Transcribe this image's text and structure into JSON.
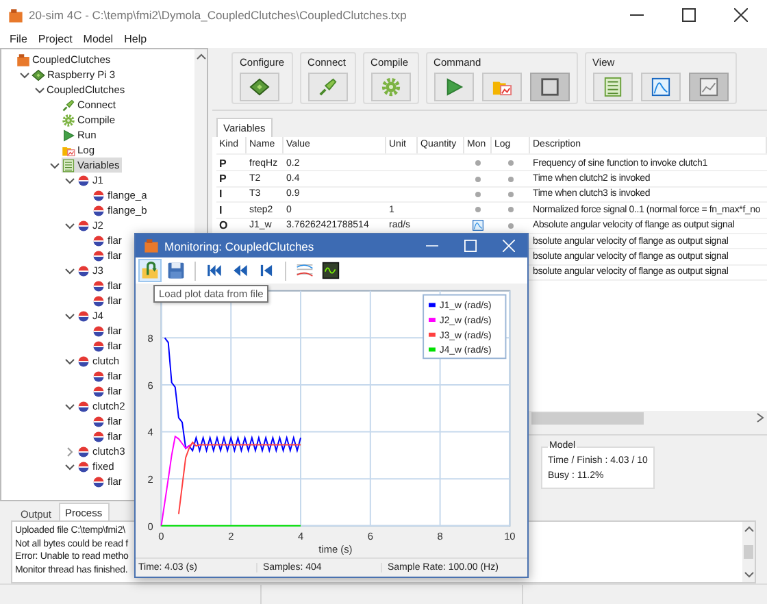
{
  "window": {
    "title": "20-sim 4C - C:\\temp\\fmi2\\Dymola_CoupledClutches\\CoupledClutches.txp"
  },
  "menu": [
    "File",
    "Project",
    "Model",
    "Help"
  ],
  "tree": [
    {
      "label": "CoupledClutches",
      "kind": "project",
      "selected": false,
      "children": [
        {
          "label": "Raspberry Pi 3",
          "kind": "board",
          "selected": false,
          "expanded": true,
          "children": [
            {
              "label": "CoupledClutches",
              "selected": false,
              "expanded": true,
              "children": [
                {
                  "label": "Connect",
                  "kind": "connect",
                  "selected": false
                },
                {
                  "label": "Compile",
                  "kind": "compile",
                  "selected": false
                },
                {
                  "label": "Run",
                  "kind": "run",
                  "selected": false
                },
                {
                  "label": "Log",
                  "kind": "log",
                  "selected": false
                },
                {
                  "label": "Variables",
                  "kind": "variables",
                  "selected": true,
                  "expanded": true,
                  "children": [
                    {
                      "label": "J1",
                      "kind": "submodel",
                      "selected": false,
                      "expanded": true,
                      "children": [
                        {
                          "label": "flange_a",
                          "kind": "port",
                          "selected": false
                        },
                        {
                          "label": "flange_b",
                          "kind": "port",
                          "selected": false
                        }
                      ]
                    },
                    {
                      "label": "J2",
                      "kind": "submodel",
                      "selected": false,
                      "expanded": true,
                      "children": [
                        {
                          "label": "flar",
                          "kind": "port",
                          "selected": false
                        },
                        {
                          "label": "flar",
                          "kind": "port",
                          "selected": false
                        }
                      ]
                    },
                    {
                      "label": "J3",
                      "kind": "submodel",
                      "selected": false,
                      "expanded": true,
                      "children": [
                        {
                          "label": "flar",
                          "kind": "port",
                          "selected": false
                        },
                        {
                          "label": "flar",
                          "kind": "port",
                          "selected": false
                        }
                      ]
                    },
                    {
                      "label": "J4",
                      "kind": "submodel",
                      "selected": false,
                      "expanded": true,
                      "children": [
                        {
                          "label": "flar",
                          "kind": "port",
                          "selected": false
                        },
                        {
                          "label": "flar",
                          "kind": "port",
                          "selected": false
                        }
                      ]
                    },
                    {
                      "label": "clutch",
                      "kind": "submodel",
                      "selected": false,
                      "expanded": true,
                      "children": [
                        {
                          "label": "flar",
                          "kind": "port",
                          "selected": false
                        },
                        {
                          "label": "flar",
                          "kind": "port",
                          "selected": false
                        }
                      ]
                    },
                    {
                      "label": "clutch2",
                      "kind": "submodel",
                      "selected": false,
                      "expanded": true,
                      "children": [
                        {
                          "label": "flar",
                          "kind": "port",
                          "selected": false
                        },
                        {
                          "label": "flar",
                          "kind": "port",
                          "selected": false
                        }
                      ]
                    },
                    {
                      "label": "clutch3",
                      "kind": "submodel",
                      "selected": false,
                      "expanded": false
                    },
                    {
                      "label": "fixed",
                      "kind": "submodel",
                      "selected": false,
                      "expanded": true,
                      "children": [
                        {
                          "label": "flar",
                          "kind": "port",
                          "selected": false
                        }
                      ]
                    }
                  ]
                }
              ]
            }
          ]
        }
      ]
    }
  ],
  "toolbar": {
    "groups": [
      {
        "label": "Configure",
        "buttons": [
          {
            "kind": "chip",
            "pressed": false
          }
        ]
      },
      {
        "label": "Connect",
        "buttons": [
          {
            "kind": "plug",
            "pressed": false
          }
        ]
      },
      {
        "label": "Compile",
        "buttons": [
          {
            "kind": "gear",
            "pressed": false
          }
        ]
      },
      {
        "label": "Command",
        "buttons": [
          {
            "kind": "play",
            "pressed": false
          },
          {
            "kind": "folder",
            "pressed": false
          },
          {
            "kind": "stop",
            "pressed": true
          }
        ]
      },
      {
        "label": "View",
        "buttons": [
          {
            "kind": "list",
            "pressed": false
          },
          {
            "kind": "plot",
            "pressed": false
          },
          {
            "kind": "plot_alt",
            "pressed": true
          }
        ]
      }
    ]
  },
  "variables_tab": "Variables",
  "table": {
    "columns": [
      "Kind",
      "Name",
      "Value",
      "Unit",
      "Quantity",
      "Mon",
      "Log",
      "Description"
    ],
    "rows": [
      {
        "kind_label": "P",
        "name": "freqHz",
        "value": "0.2",
        "monitored": false,
        "logged": false,
        "description": "Frequency of sine function to invoke clutch1"
      },
      {
        "kind_label": "P",
        "name": "T2",
        "value": "0.4",
        "monitored": false,
        "logged": false,
        "description": "Time when clutch2 is invoked"
      },
      {
        "kind_label": "I",
        "name": "T3",
        "value": "0.9",
        "monitored": false,
        "logged": false,
        "description": "Time when clutch3 is invoked"
      },
      {
        "kind_label": "I",
        "name": "step2",
        "value": "0",
        "unit": "1",
        "monitored": false,
        "logged": false,
        "description": "Normalized force signal 0..1 (normal force = fn_max*f_no"
      },
      {
        "kind_label": "O",
        "name": "J1_w",
        "value": "3.76262421788514",
        "unit": "rad/s",
        "monitored": true,
        "logged": false,
        "description": "Absolute angular velocity of flange as output signal"
      },
      {
        "description": "bsolute angular velocity of flange as output signal"
      },
      {
        "description": "bsolute angular velocity of flange as output signal"
      },
      {
        "description": "bsolute angular velocity of flange as output signal"
      }
    ]
  },
  "model_box": {
    "title": "Model",
    "lines": [
      "Time / Finish : 4.03 / 10",
      "Busy : 11.2%"
    ]
  },
  "bottom_tabs": [
    {
      "label": "Output",
      "selected": false
    },
    {
      "label": "Process",
      "selected": true
    }
  ],
  "log": [
    "Uploaded file C:\\temp\\fmi2\\",
    "Not all bytes could be read f",
    "Error: Unable to read metho",
    "Monitor thread has finished."
  ],
  "monitor": {
    "title": "Monitoring: CoupledClutches",
    "tool_groups": [
      [
        {
          "kind": "load",
          "highlighted": true
        },
        {
          "kind": "save",
          "highlighted": false
        }
      ],
      [
        {
          "kind": "first",
          "highlighted": false
        },
        {
          "kind": "rewind",
          "highlighted": false
        },
        {
          "kind": "step_back",
          "highlighted": false
        }
      ],
      [
        {
          "kind": "plot_settings",
          "highlighted": false
        },
        {
          "kind": "scope",
          "highlighted": false
        }
      ]
    ],
    "tooltip": "Load plot data from file",
    "chart_data": {
      "type": "line",
      "xlabel": "time (s)",
      "grid": true,
      "legend": true,
      "xlim": [
        0,
        10
      ],
      "ylim": [
        0,
        10
      ],
      "xticks": [
        0,
        2,
        4,
        6,
        8,
        10
      ],
      "yticks": [
        0,
        2,
        4,
        6,
        8
      ],
      "x": [
        0,
        0.1,
        0.2,
        0.3,
        0.4,
        0.5,
        0.6,
        0.7,
        0.8,
        0.9,
        1.0,
        1.1,
        1.2,
        1.3,
        1.4,
        1.5,
        1.6,
        1.7,
        1.8,
        1.9,
        2.0,
        2.1,
        2.2,
        2.3,
        2.4,
        2.5,
        2.6,
        2.7,
        2.8,
        2.9,
        3.0,
        3.1,
        3.2,
        3.3,
        3.4,
        3.5,
        3.6,
        3.7,
        3.8,
        3.9,
        4.0
      ],
      "series": [
        {
          "name": "J1_w (rad/s)",
          "color": "#0000ff",
          "values": [
            null,
            8,
            7.8,
            6.1,
            5.9,
            4.6,
            4.4,
            3.3,
            3.4,
            3.2,
            3.75,
            3.2,
            3.75,
            3.2,
            3.75,
            3.2,
            3.75,
            3.2,
            3.75,
            3.2,
            3.75,
            3.2,
            3.75,
            3.2,
            3.75,
            3.2,
            3.75,
            3.2,
            3.75,
            3.2,
            3.75,
            3.2,
            3.75,
            3.2,
            3.75,
            3.2,
            3.75,
            3.2,
            3.75,
            3.2,
            3.75
          ]
        },
        {
          "name": "J2_w (rad/s)",
          "color": "#ff00ff",
          "values": [
            0,
            1,
            2,
            3,
            3.8,
            3.7,
            3.5,
            3.3,
            3.4,
            3.5,
            null,
            null,
            null,
            null,
            null,
            null,
            null,
            null,
            null,
            null,
            null,
            null,
            null,
            null,
            null,
            null,
            null,
            null,
            null,
            null,
            null,
            null,
            null,
            null,
            null,
            null,
            null,
            null,
            null,
            null,
            null
          ]
        },
        {
          "name": "J3_w (rad/s)",
          "color": "#ff4040",
          "values": [
            null,
            null,
            null,
            null,
            null,
            0.5,
            1.7,
            2.9,
            3.3,
            3.55,
            3.4,
            3.45,
            3.45,
            3.45,
            3.45,
            3.45,
            3.45,
            3.45,
            3.45,
            3.45,
            3.45,
            3.45,
            3.45,
            3.45,
            3.45,
            3.45,
            3.45,
            3.45,
            3.45,
            3.45,
            3.45,
            3.45,
            3.45,
            3.45,
            3.45,
            3.45,
            3.45,
            3.45,
            3.45,
            3.45,
            3.45
          ]
        },
        {
          "name": "J4_w (rad/s)",
          "color": "#00e000",
          "values": [
            0,
            0,
            0,
            0,
            0,
            0,
            0,
            0,
            0,
            0,
            0,
            0,
            0,
            0,
            0,
            0,
            0,
            0,
            0,
            0,
            0,
            0,
            0,
            0,
            0,
            0,
            0,
            0,
            0,
            0,
            0,
            0,
            0,
            0,
            0,
            0,
            0,
            0,
            0,
            0,
            0
          ]
        }
      ]
    },
    "status": [
      "Time: 4.03 (s)",
      "Samples: 404",
      "Sample Rate: 100.00 (Hz)"
    ]
  }
}
